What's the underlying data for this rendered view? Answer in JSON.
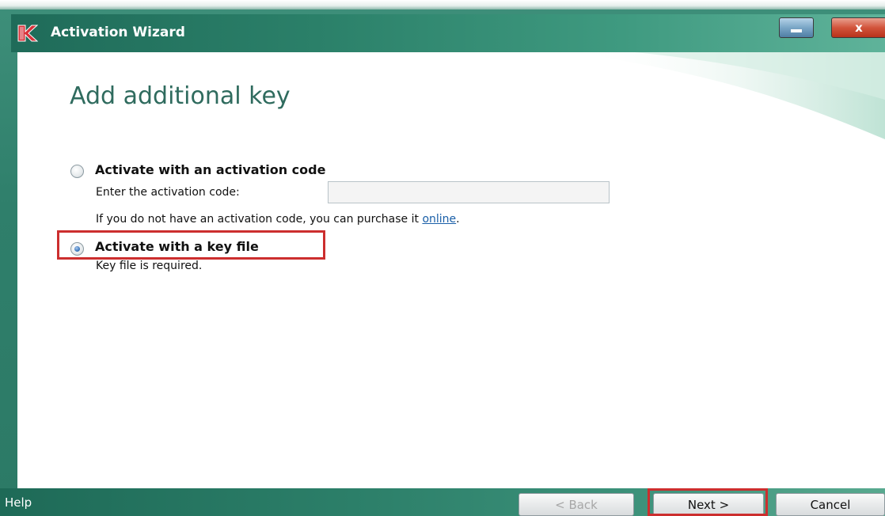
{
  "window": {
    "title": "Activation Wizard",
    "close_label": "x"
  },
  "page": {
    "title": "Add additional key"
  },
  "options": {
    "code": {
      "label": "Activate with an activation code",
      "selected": false,
      "field_label": "Enter the activation code:",
      "field_value": "",
      "purchase_text": "If you do not have an activation code, you can purchase it ",
      "purchase_link": "online",
      "purchase_end": "."
    },
    "keyfile": {
      "label": "Activate with a key file",
      "selected": true,
      "note": "Key file is required."
    }
  },
  "footer": {
    "help_label": "Help",
    "back_label": "< Back",
    "next_label": "Next >",
    "cancel_label": "Cancel"
  },
  "colors": {
    "accent_green": "#2c7f69",
    "title_green": "#2f6b5e",
    "highlight_red": "#cc2e2e",
    "link_blue": "#1a5fa8"
  },
  "icons": [
    "kaspersky-logo-icon",
    "minimize-icon",
    "close-icon"
  ]
}
